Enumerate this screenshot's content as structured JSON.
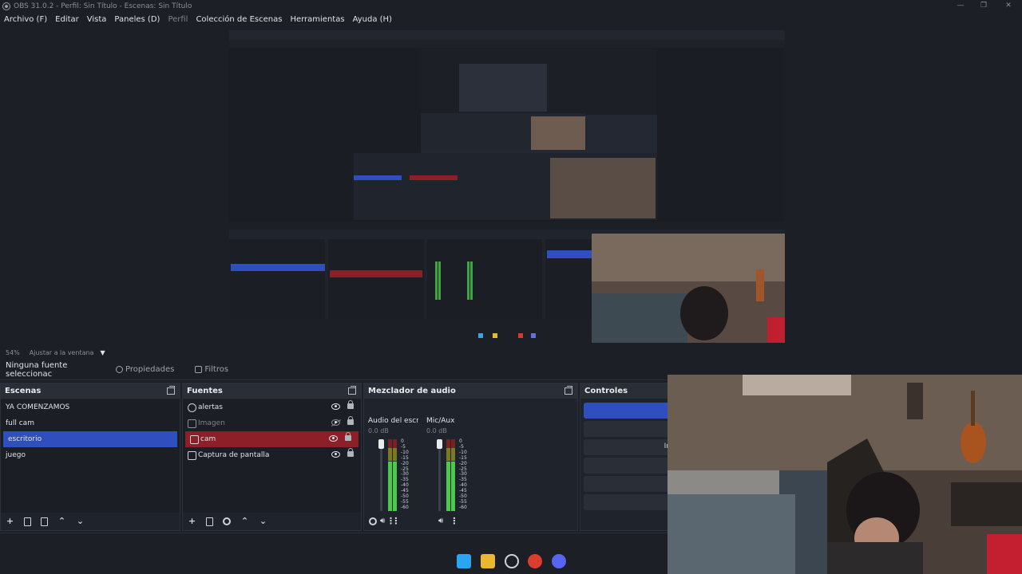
{
  "titlebar": {
    "title": "OBS 31.0.2 - Perfil: Sin Título - Escenas: Sin Título",
    "minimize": "—",
    "maximize": "❐",
    "close": "✕"
  },
  "menu": [
    "Archivo (F)",
    "Editar",
    "Vista",
    "Paneles (D)",
    "Perfil",
    "Colección de Escenas",
    "Herramientas",
    "Ayuda (H)"
  ],
  "zoom": {
    "percent": "54%",
    "fit": "Ajustar a la ventana"
  },
  "source_bar": {
    "no_selection": "Ninguna fuente seleccionac",
    "properties": "Propiedades",
    "filters": "Filtros"
  },
  "scenes": {
    "title": "Escenas",
    "items": [
      {
        "label": "YA COMENZAMOS",
        "selected": false
      },
      {
        "label": "full cam",
        "selected": false
      },
      {
        "label": "escritorio",
        "selected": true
      },
      {
        "label": "juego",
        "selected": false
      }
    ]
  },
  "sources": {
    "title": "Fuentes",
    "items": [
      {
        "label": "alertas",
        "icon": "globe-icon",
        "visible": true,
        "selected": false
      },
      {
        "label": "Imagen",
        "icon": "image-icon",
        "visible": false,
        "selected": false
      },
      {
        "label": "cam",
        "icon": "camera-icon",
        "visible": true,
        "selected": true
      },
      {
        "label": "Captura de pantalla",
        "icon": "monitor-icon",
        "visible": true,
        "selected": false
      }
    ]
  },
  "mixer": {
    "title": "Mezclador de audio",
    "channels": [
      {
        "name": "Audio del escrito",
        "db": "0.0 dB"
      },
      {
        "name": "Mic/Aux",
        "db": "0.0 dB"
      }
    ],
    "scale": [
      "0",
      "-5",
      "-10",
      "-15",
      "-20",
      "-25",
      "-30",
      "-35",
      "-40",
      "-45",
      "-50",
      "-55",
      "-60"
    ]
  },
  "controls": {
    "title": "Controles",
    "partial_label": "In"
  },
  "colors": {
    "accent_blue": "#2f4fbf",
    "selected_red": "#8c1f28",
    "panel": "#1f232b",
    "background": "#1c1f26"
  }
}
